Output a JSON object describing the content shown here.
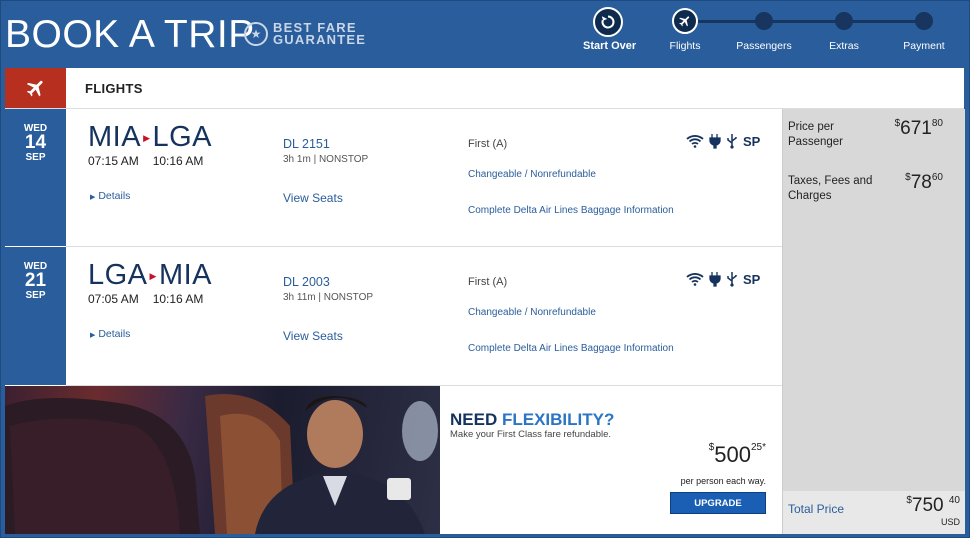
{
  "header": {
    "title": "BOOK A TRIP",
    "badge_line1": "BEST FARE",
    "badge_line2": "GUARANTEE",
    "start_over": "Start Over",
    "steps": [
      "Flights",
      "Passengers",
      "Extras",
      "Payment"
    ]
  },
  "section_label": "FLIGHTS",
  "segments": [
    {
      "day": "WED",
      "date": "14",
      "month": "SEP",
      "origin": "MIA",
      "destination": "LGA",
      "depart": "07:15 AM",
      "arrive": "10:16 AM",
      "details": "Details",
      "flight_no": "DL 2151",
      "duration": "3h 1m | NONSTOP",
      "view_seats": "View Seats",
      "cabin": "First (A)",
      "fare_rules": "Changeable / Nonrefundable",
      "baggage": "Complete Delta Air Lines Baggage Information",
      "amenity_sp": "SP"
    },
    {
      "day": "WED",
      "date": "21",
      "month": "SEP",
      "origin": "LGA",
      "destination": "MIA",
      "depart": "07:05 AM",
      "arrive": "10:16 AM",
      "details": "Details",
      "flight_no": "DL 2003",
      "duration": "3h 11m | NONSTOP",
      "view_seats": "View Seats",
      "cabin": "First (A)",
      "fare_rules": "Changeable / Nonrefundable",
      "baggage": "Complete Delta Air Lines Baggage Information",
      "amenity_sp": "SP"
    }
  ],
  "pricing": {
    "per_passenger_label": "Price per Passenger",
    "per_passenger_dollars": "671",
    "per_passenger_cents": "80",
    "taxes_label": "Taxes, Fees and Charges",
    "taxes_dollars": "78",
    "taxes_cents": "60",
    "total_label": "Total Price",
    "total_dollars": "750",
    "total_cents": "40",
    "currency": "USD",
    "currency_symbol": "$"
  },
  "promo": {
    "need": "NEED",
    "flexibility": "FLEXIBILITY?",
    "subtitle": "Make your First Class fare refundable.",
    "price_dollars": "500",
    "price_cents": "25",
    "price_mark": "*",
    "per_person": "per person each way.",
    "upgrade": "UPGRADE"
  },
  "colors": {
    "brand_blue": "#2a5d9b",
    "navy": "#16335e",
    "accent_red": "#c8102e",
    "link_blue": "#2a5d9b"
  }
}
